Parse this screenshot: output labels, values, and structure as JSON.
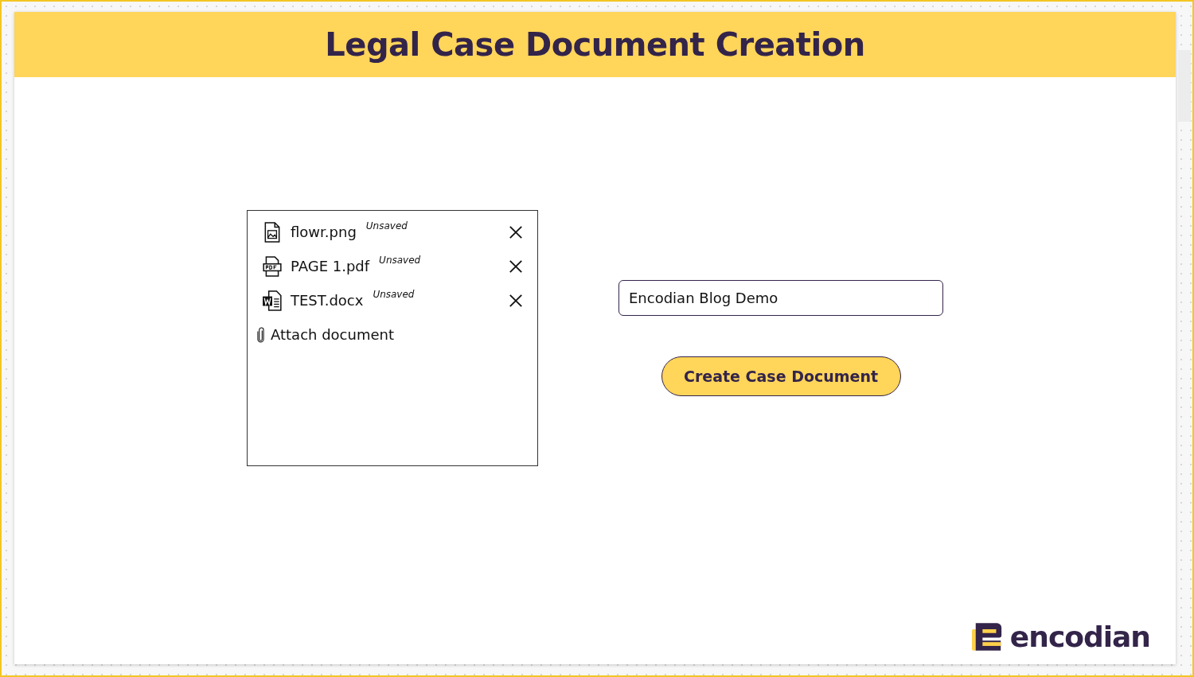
{
  "header": {
    "title": "Legal Case Document Creation"
  },
  "attachments": {
    "files": [
      {
        "name": "flowr.png",
        "status": "Unsaved",
        "kind": "image"
      },
      {
        "name": "PAGE 1.pdf",
        "status": "Unsaved",
        "kind": "pdf"
      },
      {
        "name": "TEST.docx",
        "status": "Unsaved",
        "kind": "word"
      }
    ],
    "attach_label": "Attach document"
  },
  "case_name_field": {
    "value": "Encodian Blog Demo"
  },
  "create_button": {
    "label": "Create Case Document"
  },
  "logo": {
    "text": "encodian"
  }
}
